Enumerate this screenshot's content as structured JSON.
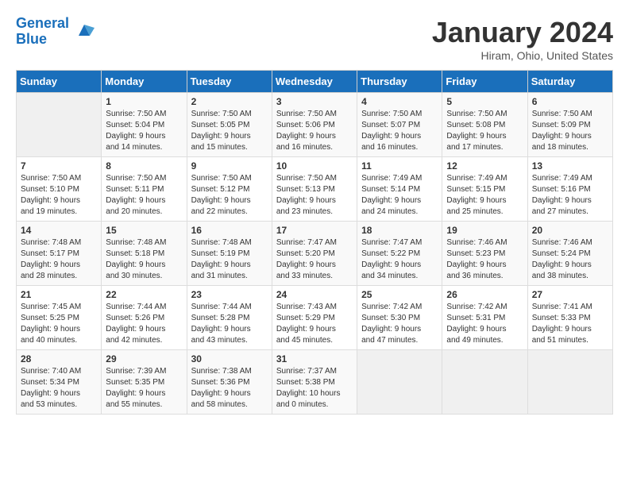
{
  "logo": {
    "line1": "General",
    "line2": "Blue"
  },
  "title": "January 2024",
  "location": "Hiram, Ohio, United States",
  "weekdays": [
    "Sunday",
    "Monday",
    "Tuesday",
    "Wednesday",
    "Thursday",
    "Friday",
    "Saturday"
  ],
  "weeks": [
    [
      {
        "day": "",
        "info": ""
      },
      {
        "day": "1",
        "info": "Sunrise: 7:50 AM\nSunset: 5:04 PM\nDaylight: 9 hours\nand 14 minutes."
      },
      {
        "day": "2",
        "info": "Sunrise: 7:50 AM\nSunset: 5:05 PM\nDaylight: 9 hours\nand 15 minutes."
      },
      {
        "day": "3",
        "info": "Sunrise: 7:50 AM\nSunset: 5:06 PM\nDaylight: 9 hours\nand 16 minutes."
      },
      {
        "day": "4",
        "info": "Sunrise: 7:50 AM\nSunset: 5:07 PM\nDaylight: 9 hours\nand 16 minutes."
      },
      {
        "day": "5",
        "info": "Sunrise: 7:50 AM\nSunset: 5:08 PM\nDaylight: 9 hours\nand 17 minutes."
      },
      {
        "day": "6",
        "info": "Sunrise: 7:50 AM\nSunset: 5:09 PM\nDaylight: 9 hours\nand 18 minutes."
      }
    ],
    [
      {
        "day": "7",
        "info": "Sunrise: 7:50 AM\nSunset: 5:10 PM\nDaylight: 9 hours\nand 19 minutes."
      },
      {
        "day": "8",
        "info": "Sunrise: 7:50 AM\nSunset: 5:11 PM\nDaylight: 9 hours\nand 20 minutes."
      },
      {
        "day": "9",
        "info": "Sunrise: 7:50 AM\nSunset: 5:12 PM\nDaylight: 9 hours\nand 22 minutes."
      },
      {
        "day": "10",
        "info": "Sunrise: 7:50 AM\nSunset: 5:13 PM\nDaylight: 9 hours\nand 23 minutes."
      },
      {
        "day": "11",
        "info": "Sunrise: 7:49 AM\nSunset: 5:14 PM\nDaylight: 9 hours\nand 24 minutes."
      },
      {
        "day": "12",
        "info": "Sunrise: 7:49 AM\nSunset: 5:15 PM\nDaylight: 9 hours\nand 25 minutes."
      },
      {
        "day": "13",
        "info": "Sunrise: 7:49 AM\nSunset: 5:16 PM\nDaylight: 9 hours\nand 27 minutes."
      }
    ],
    [
      {
        "day": "14",
        "info": "Sunrise: 7:48 AM\nSunset: 5:17 PM\nDaylight: 9 hours\nand 28 minutes."
      },
      {
        "day": "15",
        "info": "Sunrise: 7:48 AM\nSunset: 5:18 PM\nDaylight: 9 hours\nand 30 minutes."
      },
      {
        "day": "16",
        "info": "Sunrise: 7:48 AM\nSunset: 5:19 PM\nDaylight: 9 hours\nand 31 minutes."
      },
      {
        "day": "17",
        "info": "Sunrise: 7:47 AM\nSunset: 5:20 PM\nDaylight: 9 hours\nand 33 minutes."
      },
      {
        "day": "18",
        "info": "Sunrise: 7:47 AM\nSunset: 5:22 PM\nDaylight: 9 hours\nand 34 minutes."
      },
      {
        "day": "19",
        "info": "Sunrise: 7:46 AM\nSunset: 5:23 PM\nDaylight: 9 hours\nand 36 minutes."
      },
      {
        "day": "20",
        "info": "Sunrise: 7:46 AM\nSunset: 5:24 PM\nDaylight: 9 hours\nand 38 minutes."
      }
    ],
    [
      {
        "day": "21",
        "info": "Sunrise: 7:45 AM\nSunset: 5:25 PM\nDaylight: 9 hours\nand 40 minutes."
      },
      {
        "day": "22",
        "info": "Sunrise: 7:44 AM\nSunset: 5:26 PM\nDaylight: 9 hours\nand 42 minutes."
      },
      {
        "day": "23",
        "info": "Sunrise: 7:44 AM\nSunset: 5:28 PM\nDaylight: 9 hours\nand 43 minutes."
      },
      {
        "day": "24",
        "info": "Sunrise: 7:43 AM\nSunset: 5:29 PM\nDaylight: 9 hours\nand 45 minutes."
      },
      {
        "day": "25",
        "info": "Sunrise: 7:42 AM\nSunset: 5:30 PM\nDaylight: 9 hours\nand 47 minutes."
      },
      {
        "day": "26",
        "info": "Sunrise: 7:42 AM\nSunset: 5:31 PM\nDaylight: 9 hours\nand 49 minutes."
      },
      {
        "day": "27",
        "info": "Sunrise: 7:41 AM\nSunset: 5:33 PM\nDaylight: 9 hours\nand 51 minutes."
      }
    ],
    [
      {
        "day": "28",
        "info": "Sunrise: 7:40 AM\nSunset: 5:34 PM\nDaylight: 9 hours\nand 53 minutes."
      },
      {
        "day": "29",
        "info": "Sunrise: 7:39 AM\nSunset: 5:35 PM\nDaylight: 9 hours\nand 55 minutes."
      },
      {
        "day": "30",
        "info": "Sunrise: 7:38 AM\nSunset: 5:36 PM\nDaylight: 9 hours\nand 58 minutes."
      },
      {
        "day": "31",
        "info": "Sunrise: 7:37 AM\nSunset: 5:38 PM\nDaylight: 10 hours\nand 0 minutes."
      },
      {
        "day": "",
        "info": ""
      },
      {
        "day": "",
        "info": ""
      },
      {
        "day": "",
        "info": ""
      }
    ]
  ]
}
